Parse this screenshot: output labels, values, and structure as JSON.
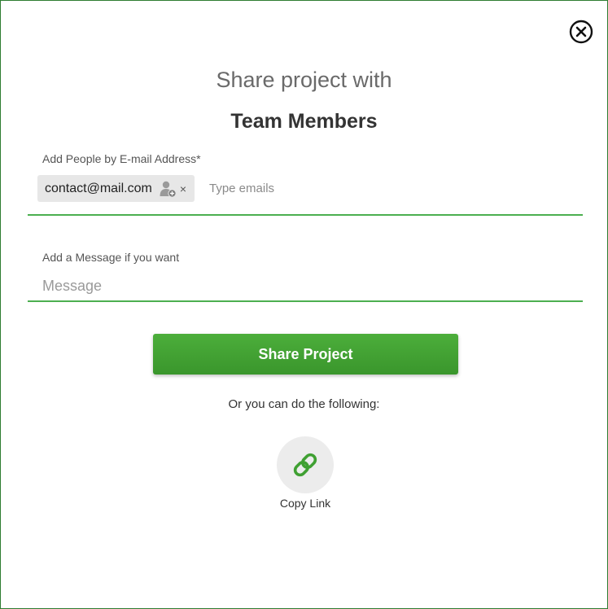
{
  "dialog": {
    "title": "Share project with",
    "subtitle": "Team Members",
    "close_icon": "close-circle-icon"
  },
  "emails": {
    "label": "Add People by E-mail Address*",
    "chips": [
      {
        "email": "contact@mail.com",
        "icon": "person-add-icon",
        "remove_label": "×"
      }
    ],
    "placeholder": "Type emails",
    "value": ""
  },
  "message": {
    "label": "Add a Message if you want",
    "placeholder": "Message",
    "value": ""
  },
  "actions": {
    "share_label": "Share Project",
    "alt_text": "Or you can do the following:",
    "copy_link_label": "Copy Link",
    "copy_link_icon": "link-icon"
  },
  "colors": {
    "accent": "#3fa032",
    "border": "#2e7d32",
    "underline": "#4caf50"
  }
}
